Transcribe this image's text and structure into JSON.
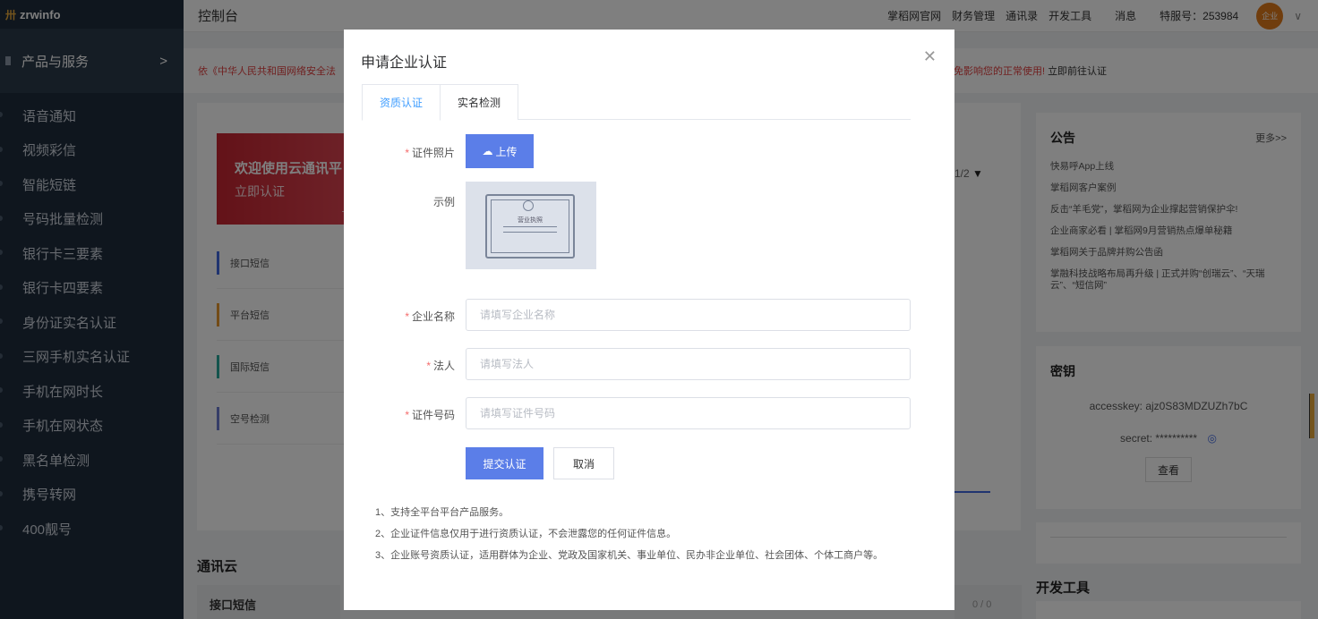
{
  "sidebar": {
    "logo": "zrwinfo",
    "group_label": "产品与服务",
    "items": [
      "语音通知",
      "视频彩信",
      "智能短链",
      "号码批量检测",
      "银行卡三要素",
      "银行卡四要素",
      "身份证实名认证",
      "三网手机实名认证",
      "手机在网时长",
      "手机在网状态",
      "黑名单检测",
      "携号转网",
      "400靓号"
    ]
  },
  "topbar": {
    "title": "控制台",
    "links": [
      "掌稻网官网",
      "财务管理",
      "通讯录",
      "开发工具",
      "消息"
    ],
    "account": "特服号：253984",
    "avatar_text": "企业"
  },
  "notice": {
    "left_text": "依《中华人民共和国网络安全法",
    "right_text": "免影响您的正常使用!",
    "link": "立即前往认证"
  },
  "welcome": {
    "title": "欢迎使用云通讯平",
    "subtitle": "立即认证"
  },
  "products": [
    "接口短信",
    "平台短信",
    "国际短信",
    "空号检测"
  ],
  "pager": "1/2",
  "section": {
    "title": "通讯云",
    "card": "接口短信",
    "count": "0 / 0"
  },
  "announcements": {
    "title": "公告",
    "more": "更多>>",
    "items": [
      "快易呼App上线",
      "掌稻网客户案例",
      "反击“羊毛党”，掌稻网为企业撑起营销保护伞!",
      "企业商家必看 | 掌稻网9月营销热点爆单秘籍",
      "掌稻网关于品牌并购公告函",
      "掌融科技战略布局再升级 | 正式并购“创瑞云”、“天瑞云”、“短信网”"
    ]
  },
  "keys": {
    "title": "密钥",
    "access_label": "accesskey:",
    "access_value": "ajz0S83MDZUZh7bC",
    "secret_label": "secret:",
    "secret_value": "**********",
    "view_label": "查看"
  },
  "dev_tools_title": "开发工具",
  "modal": {
    "title": "申请企业认证",
    "tabs": [
      "资质认证",
      "实名检测"
    ],
    "photo_label": "证件照片",
    "upload_label": "上传",
    "sample_label": "示例",
    "cert_text": "营业执照",
    "company": {
      "label": "企业名称",
      "placeholder": "请填写企业名称"
    },
    "legal": {
      "label": "法人",
      "placeholder": "请填写法人"
    },
    "id_number": {
      "label": "证件号码",
      "placeholder": "请填写证件号码"
    },
    "submit_label": "提交认证",
    "cancel_label": "取消",
    "notes": [
      "1、支持全平台平台产品服务。",
      "2、企业证件信息仅用于进行资质认证，不会泄露您的任何证件信息。",
      "3、企业账号资质认证，适用群体为企业、党政及国家机关、事业单位、民办非企业单位、社会团体、个体工商户等。"
    ]
  },
  "colors": {
    "sidebar_bg": "#1f2d3d",
    "primary_button": "#5b7ee8",
    "active_tab": "#409eff",
    "required": "#f56c6c",
    "notice_red": "#e04040",
    "avatar": "#e07b1b"
  }
}
